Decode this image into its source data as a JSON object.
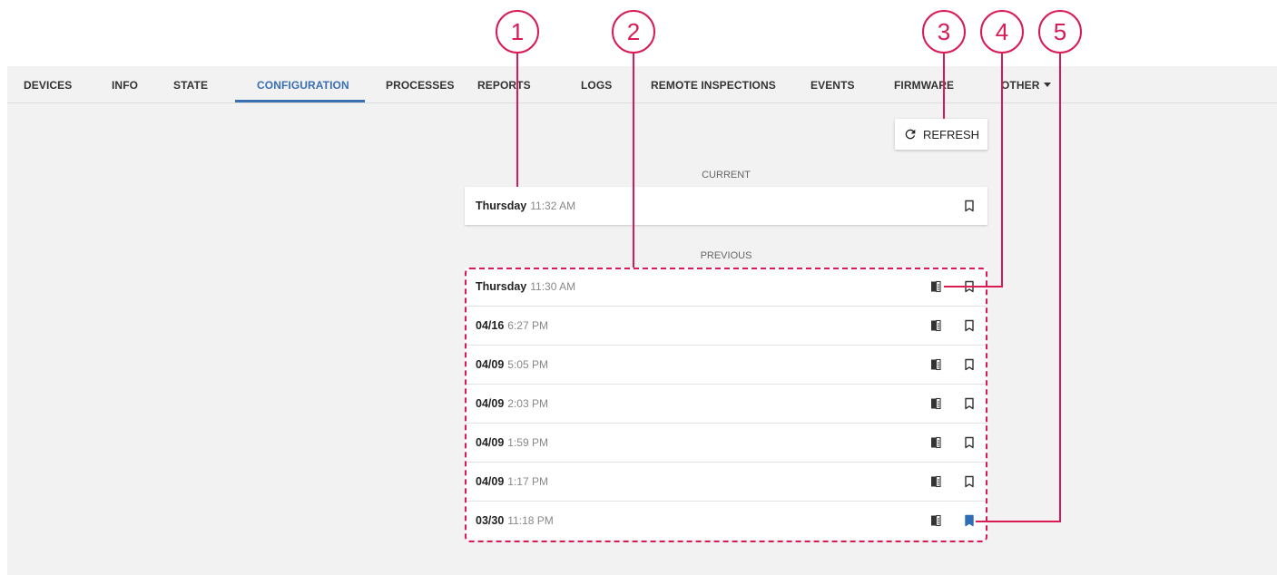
{
  "nav": {
    "tabs": [
      {
        "label": "DEVICES"
      },
      {
        "label": "INFO"
      },
      {
        "label": "STATE"
      },
      {
        "label": "CONFIGURATION",
        "active": true
      },
      {
        "label": "PROCESSES"
      },
      {
        "label": "REPORTS"
      },
      {
        "label": "LOGS"
      },
      {
        "label": "REMOTE INSPECTIONS"
      },
      {
        "label": "EVENTS"
      },
      {
        "label": "FIRMWARE"
      },
      {
        "label": "OTHER"
      }
    ]
  },
  "refresh": {
    "label": "REFRESH",
    "icon": "refresh-icon"
  },
  "current": {
    "section_label": "CURRENT",
    "item": {
      "date": "Thursday",
      "time": "11:32 AM",
      "bookmarked": false
    }
  },
  "previous": {
    "section_label": "PREVIOUS",
    "items": [
      {
        "date": "Thursday",
        "time": "11:30 AM",
        "bookmarked": false
      },
      {
        "date": "04/16",
        "time": "6:27 PM",
        "bookmarked": false
      },
      {
        "date": "04/09",
        "time": "5:05 PM",
        "bookmarked": false
      },
      {
        "date": "04/09",
        "time": "2:03 PM",
        "bookmarked": false
      },
      {
        "date": "04/09",
        "time": "1:59 PM",
        "bookmarked": false
      },
      {
        "date": "04/09",
        "time": "1:17 PM",
        "bookmarked": false
      },
      {
        "date": "03/30",
        "time": "11:18 PM",
        "bookmarked": true
      }
    ]
  },
  "callouts": [
    "1",
    "2",
    "3",
    "4",
    "5"
  ],
  "colors": {
    "accent": "#3a6fb0",
    "callout": "#d81b55",
    "bookmark_active": "#2f6db5"
  }
}
